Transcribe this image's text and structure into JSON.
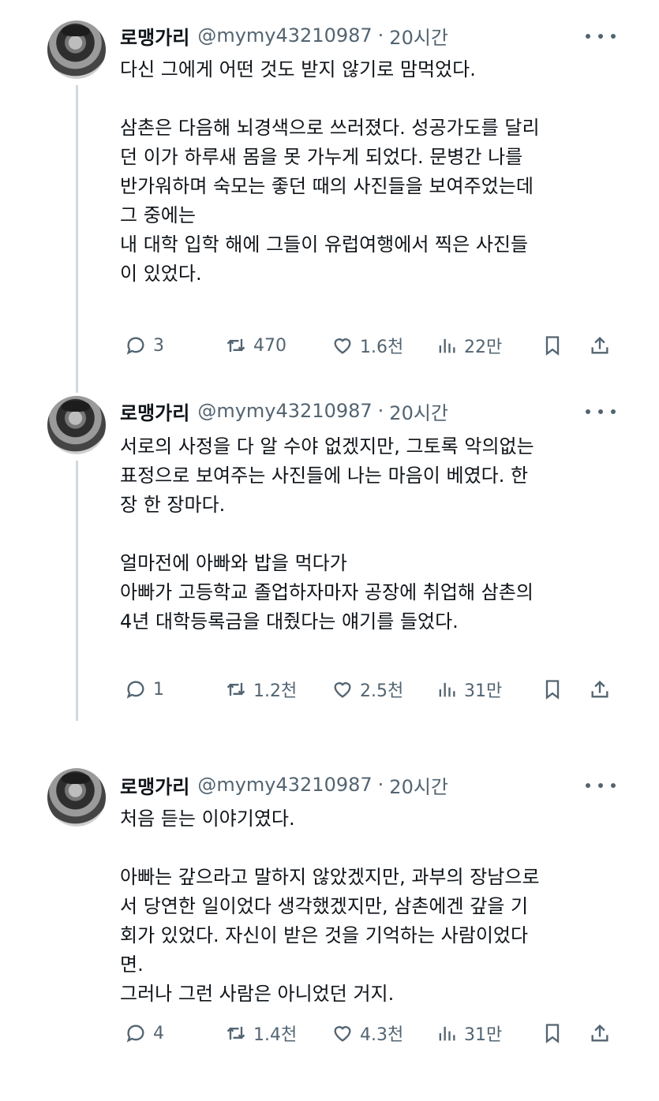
{
  "tweets": [
    {
      "name": "로맹가리",
      "handle": "@mymy43210987",
      "separator": "·",
      "time": "20시간",
      "lines": [
        "다신 그에게 어떤 것도 받지 않기로 맘먹었다.",
        "",
        "삼촌은 다음해 뇌경색으로 쓰러졌다. 성공가도를 달리",
        "던 이가 하루새 몸을 못 가누게 되었다. 문병간 나를",
        "반가워하며 숙모는 좋던 때의 사진들을 보여주었는데",
        "그 중에는",
        "내 대학 입학 해에 그들이 유럽여행에서 찍은 사진들",
        "이 있었다."
      ],
      "replies": "3",
      "retweets": "470",
      "likes": "1.6천",
      "views": "22만"
    },
    {
      "name": "로맹가리",
      "handle": "@mymy43210987",
      "separator": "·",
      "time": "20시간",
      "lines": [
        "서로의 사정을 다 알 수야 없겠지만, 그토록 악의없는",
        "표정으로 보여주는 사진들에 나는 마음이 베였다. 한",
        "장 한 장마다.",
        "",
        "얼마전에 아빠와 밥을 먹다가",
        "아빠가 고등학교 졸업하자마자 공장에 취업해 삼촌의",
        "4년 대학등록금을 대줬다는 얘기를 들었다."
      ],
      "replies": "1",
      "retweets": "1.2천",
      "likes": "2.5천",
      "views": "31만"
    },
    {
      "name": "로맹가리",
      "handle": "@mymy43210987",
      "separator": "·",
      "time": "20시간",
      "lines": [
        "처음 듣는 이야기였다.",
        "",
        "아빠는 갚으라고 말하지 않았겠지만, 과부의 장남으로",
        "서 당연한 일이었다 생각했겠지만, 삼촌에겐 갚을 기",
        "회가 있었다. 자신이 받은 것을 기억하는 사람이었다",
        "면.",
        "그러나 그런 사람은 아니었던 거지."
      ],
      "replies": "4",
      "retweets": "1.4천",
      "likes": "4.3천",
      "views": "31만"
    }
  ]
}
